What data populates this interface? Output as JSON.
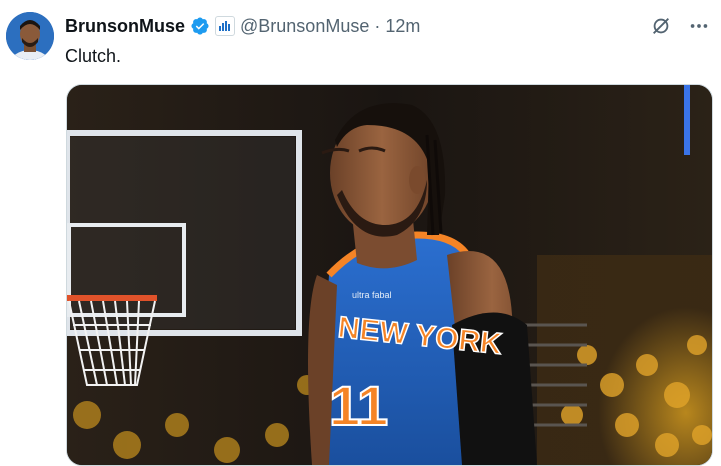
{
  "tweet": {
    "author_name": "BrunsonMuse",
    "handle": "@BrunsonMuse",
    "separator": "·",
    "time": "12m",
    "text": "Clutch.",
    "icons": {
      "verified": "verified-badge-icon",
      "affiliation": "affiliation-badge-icon",
      "grok": "grok-icon",
      "more": "more-icon"
    },
    "jersey_text": "NEW YORK",
    "jersey_number": "11",
    "jersey_sponsor": "ultra fabal",
    "colors": {
      "verified_blue": "#1d9bf0",
      "knicks_blue": "#1d5fb8",
      "knicks_orange": "#f58426"
    }
  }
}
